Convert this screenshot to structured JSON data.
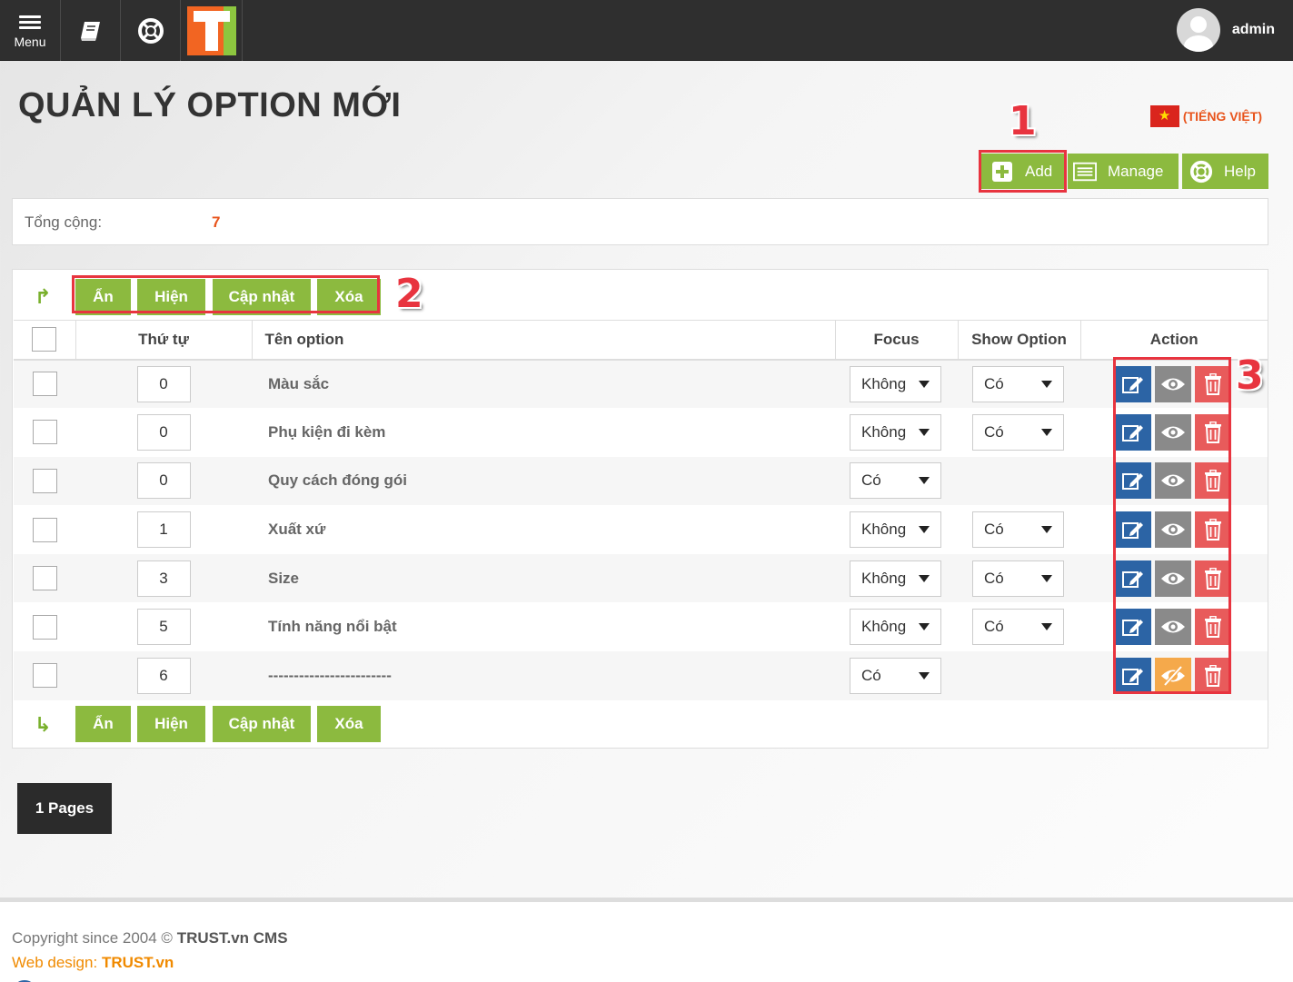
{
  "topbar": {
    "menu_label": "Menu",
    "username": "admin",
    "icons": [
      "menu-icon",
      "book-icon",
      "lifebuoy-icon",
      "trust-logo"
    ]
  },
  "page": {
    "title": "QUẢN LÝ OPTION MỚI",
    "language": "(TIẾNG VIỆT)"
  },
  "toolbar": {
    "add_label": "Add",
    "manage_label": "Manage",
    "help_label": "Help"
  },
  "annotations": [
    "1",
    "2",
    "3"
  ],
  "summary": {
    "total_label": "Tổng cộng:",
    "total_value": "7"
  },
  "bulk_actions": {
    "hide": "Ẩn",
    "show": "Hiện",
    "update": "Cập nhật",
    "delete": "Xóa"
  },
  "table": {
    "headers": {
      "order": "Thứ tự",
      "name": "Tên option",
      "focus": "Focus",
      "show_option": "Show Option",
      "action": "Action"
    },
    "rows": [
      {
        "order": "0",
        "name": "Màu sắc",
        "focus": "Không",
        "show_option": "Có",
        "visible": true
      },
      {
        "order": "0",
        "name": "Phụ kiện đi kèm",
        "focus": "Không",
        "show_option": "Có",
        "visible": true
      },
      {
        "order": "0",
        "name": "Quy cách đóng gói",
        "focus": "Có",
        "show_option": "",
        "visible": true
      },
      {
        "order": "1",
        "name": "Xuất xứ",
        "focus": "Không",
        "show_option": "Có",
        "visible": true
      },
      {
        "order": "3",
        "name": "Size",
        "focus": "Không",
        "show_option": "Có",
        "visible": true
      },
      {
        "order": "5",
        "name": "Tính năng nổi bật",
        "focus": "Không",
        "show_option": "Có",
        "visible": true
      },
      {
        "order": "6",
        "name": "------------------------",
        "focus": "Có",
        "show_option": "",
        "visible": false
      }
    ]
  },
  "pagination": {
    "label": "1 Pages"
  },
  "footer": {
    "copyright_prefix": "Copyright since 2004 ©",
    "copyright_brand": "TRUST.vn CMS",
    "webdesign_prefix": "Web design:",
    "webdesign_brand": "TRUST.vn"
  },
  "colors": {
    "accent_green": "#8cba3f",
    "edit_blue": "#2c64a5",
    "view_gray": "#8a8a8a",
    "view_off_orange": "#f5a94b",
    "delete_red": "#e85b5b",
    "annotation_red": "#e8343f",
    "highlight_orange": "#e8541c"
  }
}
